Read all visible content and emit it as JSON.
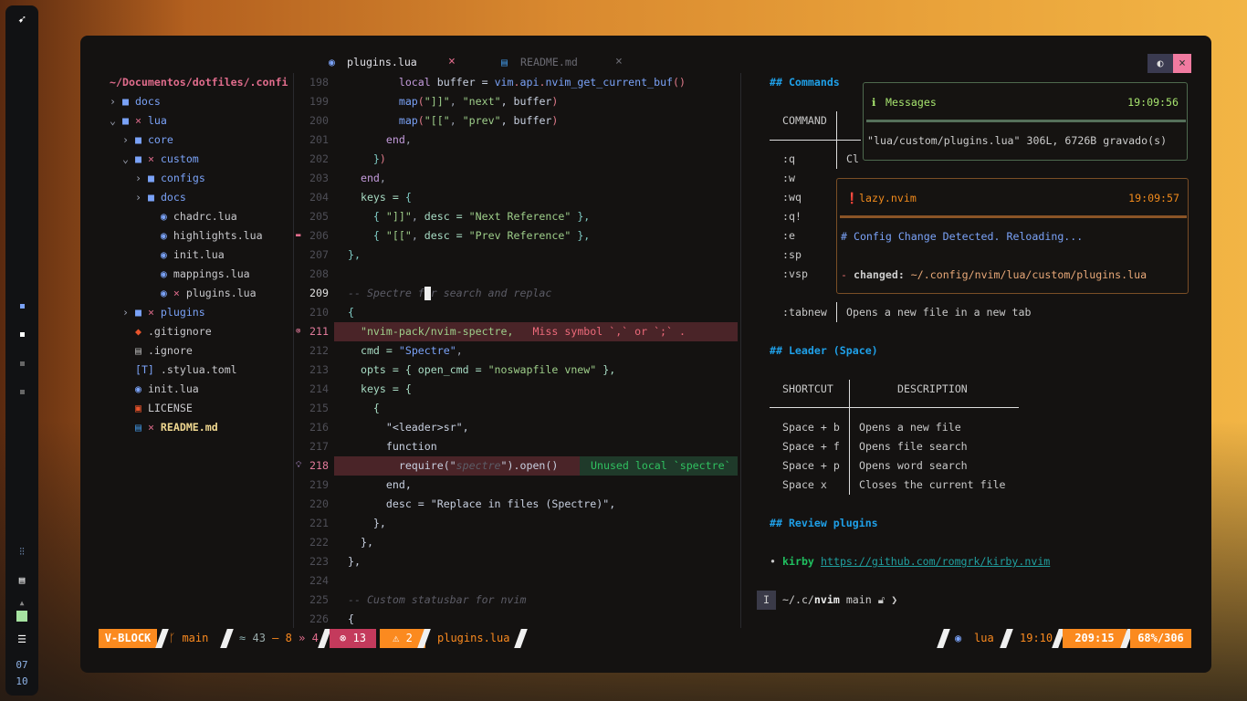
{
  "dock": {
    "clock_hour": "07",
    "clock_min": "10"
  },
  "tabs": [
    {
      "label": "plugins.lua",
      "close": "×",
      "icon": "lua-icon"
    },
    {
      "label": "README.md",
      "close": "×",
      "icon": "markdown-file-icon"
    }
  ],
  "window_buttons": {
    "toggle": "toggle-icon",
    "close": "×"
  },
  "tree": {
    "root": "~/Documentos/dotfiles/.confi",
    "items": [
      {
        "label": "docs",
        "type": "dir",
        "open": false,
        "depth": 0,
        "modified": false
      },
      {
        "label": "lua",
        "type": "dir",
        "open": true,
        "depth": 0,
        "modified": true
      },
      {
        "label": "core",
        "type": "dir",
        "open": false,
        "depth": 1,
        "modified": false
      },
      {
        "label": "custom",
        "type": "dir",
        "open": true,
        "depth": 1,
        "modified": true
      },
      {
        "label": "configs",
        "type": "dir",
        "open": false,
        "depth": 2,
        "modified": false
      },
      {
        "label": "docs",
        "type": "dir",
        "open": false,
        "depth": 2,
        "modified": false
      },
      {
        "label": "chadrc.lua",
        "type": "lua",
        "depth": 2,
        "modified": false
      },
      {
        "label": "highlights.lua",
        "type": "lua",
        "depth": 2,
        "modified": false
      },
      {
        "label": "init.lua",
        "type": "lua",
        "depth": 2,
        "modified": false
      },
      {
        "label": "mappings.lua",
        "type": "lua",
        "depth": 2,
        "modified": false
      },
      {
        "label": "plugins.lua",
        "type": "lua",
        "depth": 2,
        "modified": true
      },
      {
        "label": "plugins",
        "type": "dir",
        "open": false,
        "depth": 1,
        "modified": true
      },
      {
        "label": ".gitignore",
        "type": "git",
        "depth": 1,
        "modified": false
      },
      {
        "label": ".ignore",
        "type": "file",
        "depth": 1,
        "modified": false
      },
      {
        "label": ".stylua.toml",
        "type": "toml",
        "depth": 1,
        "modified": false
      },
      {
        "label": "init.lua",
        "type": "lua",
        "depth": 1,
        "modified": false
      },
      {
        "label": "LICENSE",
        "type": "license",
        "depth": 1,
        "modified": false
      },
      {
        "label": "README.md",
        "type": "md",
        "depth": 1,
        "modified": true
      }
    ]
  },
  "code": [
    {
      "n": "198",
      "s": [
        [
          "        ",
          ""
        ],
        [
          "local",
          "kw"
        ],
        [
          " buffer = ",
          "tx"
        ],
        [
          "vim",
          "fn"
        ],
        [
          ".",
          "ps"
        ],
        [
          "api",
          "fn"
        ],
        [
          ".",
          "ps"
        ],
        [
          "nvim_get_current_buf",
          "fn"
        ],
        [
          "()",
          "ps"
        ]
      ]
    },
    {
      "n": "199",
      "s": [
        [
          "        ",
          ""
        ],
        [
          "map",
          "fn"
        ],
        [
          "(",
          "ps"
        ],
        [
          "\"]]\"",
          "st"
        ],
        [
          ", ",
          "pn"
        ],
        [
          "\"next\"",
          "st"
        ],
        [
          ", buffer",
          "tx"
        ],
        [
          ")",
          "ps"
        ]
      ]
    },
    {
      "n": "200",
      "s": [
        [
          "        ",
          ""
        ],
        [
          "map",
          "fn"
        ],
        [
          "(",
          "ps"
        ],
        [
          "\"[[\"",
          "st"
        ],
        [
          ", ",
          "pn"
        ],
        [
          "\"prev\"",
          "st"
        ],
        [
          ", buffer",
          "tx"
        ],
        [
          ")",
          "ps"
        ]
      ]
    },
    {
      "n": "201",
      "s": [
        [
          "      ",
          ""
        ],
        [
          "end",
          "kw"
        ],
        [
          ",",
          "pn"
        ]
      ]
    },
    {
      "n": "202",
      "s": [
        [
          "    ",
          ""
        ],
        [
          "}",
          "br"
        ],
        [
          ")",
          "ps"
        ]
      ]
    },
    {
      "n": "203",
      "s": [
        [
          "  ",
          ""
        ],
        [
          "end",
          "kw"
        ],
        [
          ",",
          "pn"
        ]
      ]
    },
    {
      "n": "204",
      "s": [
        [
          "  ",
          ""
        ],
        [
          "keys = ",
          "id"
        ],
        [
          "{",
          "br"
        ]
      ]
    },
    {
      "n": "205",
      "s": [
        [
          "    ",
          ""
        ],
        [
          "{ ",
          "br"
        ],
        [
          "\"]]\"",
          "st"
        ],
        [
          ", ",
          "pn"
        ],
        [
          "desc = ",
          "id"
        ],
        [
          "\"Next Reference\"",
          "st"
        ],
        [
          " },",
          "br"
        ]
      ]
    },
    {
      "n": "206",
      "s": [
        [
          "    ",
          ""
        ],
        [
          "{ ",
          "br"
        ],
        [
          "\"[[\"",
          "st"
        ],
        [
          ", ",
          "pn"
        ],
        [
          "desc = ",
          "id"
        ],
        [
          "\"Prev Reference\"",
          "st"
        ],
        [
          " },",
          "br"
        ]
      ],
      "sign": "fold"
    },
    {
      "n": "207",
      "s": [
        [
          "},",
          "br"
        ]
      ]
    },
    {
      "n": "208",
      "s": []
    },
    {
      "n": "209",
      "s": [
        [
          "-- Spectre for search and replac",
          "cm"
        ]
      ],
      "current": true
    },
    {
      "n": "210",
      "s": [
        [
          "{",
          "br"
        ]
      ]
    },
    {
      "n": "211",
      "s": [
        [
          "  ",
          ""
        ],
        [
          "\"nvim-pack/nvim-spectre,",
          "st"
        ]
      ],
      "sign": "error",
      "diag": "Miss symbol `,` or `;` ."
    },
    {
      "n": "212",
      "s": [
        [
          "  ",
          ""
        ],
        [
          "cmd = ",
          "id"
        ],
        [
          "\"Spectre\"",
          "fn"
        ],
        [
          ",",
          "pn"
        ]
      ]
    },
    {
      "n": "213",
      "s": [
        [
          "  ",
          ""
        ],
        [
          "opts = { open_cmd = ",
          "id"
        ],
        [
          "\"noswapfile vnew\"",
          "st"
        ],
        [
          " },",
          "id"
        ]
      ]
    },
    {
      "n": "214",
      "s": [
        [
          "  ",
          ""
        ],
        [
          "keys = {",
          "id"
        ]
      ]
    },
    {
      "n": "215",
      "s": [
        [
          "    ",
          ""
        ],
        [
          "{",
          "id"
        ]
      ]
    },
    {
      "n": "216",
      "s": [
        [
          "      ",
          ""
        ],
        [
          "\"<leader>sr\",",
          "tx"
        ]
      ]
    },
    {
      "n": "217",
      "s": [
        [
          "      ",
          ""
        ],
        [
          "function",
          "tx"
        ]
      ]
    },
    {
      "n": "218",
      "s": [
        [
          "        ",
          ""
        ],
        [
          "require(\"",
          "tx"
        ],
        [
          "spectre",
          "cm"
        ],
        [
          "\").open()",
          "tx"
        ]
      ],
      "sign": "hint",
      "diag": "Unused local `spectre`"
    },
    {
      "n": "219",
      "s": [
        [
          "      ",
          ""
        ],
        [
          "end,",
          "tx"
        ]
      ]
    },
    {
      "n": "220",
      "s": [
        [
          "      ",
          ""
        ],
        [
          "desc = \"Replace in files (Spectre)\",",
          "tx"
        ]
      ]
    },
    {
      "n": "221",
      "s": [
        [
          "    ",
          ""
        ],
        [
          "},",
          "tx"
        ]
      ]
    },
    {
      "n": "222",
      "s": [
        [
          "  ",
          ""
        ],
        [
          "},",
          "tx"
        ]
      ]
    },
    {
      "n": "223",
      "s": [
        [
          "},",
          "tx"
        ]
      ]
    },
    {
      "n": "224",
      "s": []
    },
    {
      "n": "225",
      "s": [
        [
          "-- Custom statusbar for nvim",
          "cm"
        ]
      ]
    },
    {
      "n": "226",
      "s": [
        [
          "{",
          "tx"
        ]
      ]
    }
  ],
  "preview": {
    "h_commands": "## Commands",
    "commands_header": "COMMAND",
    "commands": [
      {
        "cmd": ":q",
        "desc": "Cl"
      },
      {
        "cmd": ":w",
        "desc": ""
      },
      {
        "cmd": ":wq",
        "desc": ""
      },
      {
        "cmd": ":q!",
        "desc": ""
      },
      {
        "cmd": ":e",
        "desc": ""
      },
      {
        "cmd": ":sp",
        "desc": ""
      },
      {
        "cmd": ":vsp",
        "desc": ""
      }
    ],
    "tabnew": {
      "cmd": ":tabnew",
      "desc": "Opens a new file in a new tab"
    },
    "h_leader": "## Leader (Space)",
    "leader_header": [
      "SHORTCUT",
      "DESCRIPTION"
    ],
    "leader": [
      {
        "k": "Space + b",
        "d": "Opens a new file"
      },
      {
        "k": "Space + f",
        "d": "Opens file search"
      },
      {
        "k": "Space + p",
        "d": "Opens word search"
      },
      {
        "k": "Space x",
        "d": "Closes the current file"
      }
    ],
    "h_review": "## Review plugins",
    "bullet": "•",
    "plugin_name": "kirby",
    "plugin_url": "https://github.com/romgrk/kirby.nvim",
    "prompt": {
      "mode": "I",
      "path": "~/.c/",
      "dir": "nvim",
      "branch": "main",
      "arrow": "❯"
    }
  },
  "notifications": [
    {
      "title": "Messages",
      "time": "19:09:56",
      "body": "\"lua/custom/plugins.lua\" 306L, 6726B gravado(s)",
      "color": "#a6e36e"
    },
    {
      "title": "lazy.nvim",
      "time": "19:09:57",
      "heading": "# Config Change Detected. Reloading...",
      "dash": "-",
      "label": "changed:",
      "path": "~/.config/nvim/lua/custom/plugins.lua",
      "color": "#f08a1c"
    }
  ],
  "statusline": {
    "mode": "V-BLOCK",
    "branch": "main",
    "added": "43",
    "changed": "8",
    "removed": "4",
    "errors": "13",
    "warnings": "2",
    "file": "plugins.lua",
    "filetype": "lua",
    "time": "19:10",
    "position": "209:15",
    "progress": "68%/306",
    "accent": "#fb8a1f",
    "error_bg": "#c43a5c"
  }
}
